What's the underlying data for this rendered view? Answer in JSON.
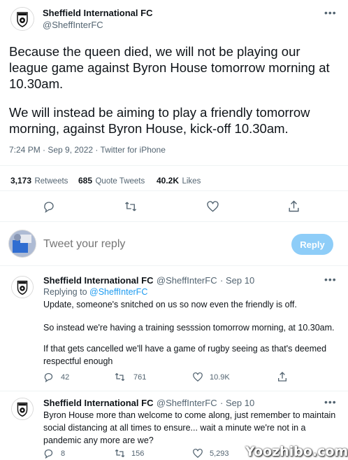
{
  "main_tweet": {
    "author_name": "Sheffield International FC",
    "author_handle": "@SheffInterFC",
    "more_icon": "more-dots-icon",
    "text_p1": "Because the queen died, we will not be playing our league game against Byron House tomorrow morning at 10.30am.",
    "text_p2": "We will instead be aiming to play a friendly tomorrow morning, against Byron House, kick-off 10.30am.",
    "timestamp": "7:24 PM · Sep 9, 2022 · Twitter for iPhone",
    "stats": {
      "retweets_count": "3,173",
      "retweets_label": "Retweets",
      "quotes_count": "685",
      "quotes_label": "Quote Tweets",
      "likes_count": "40.2K",
      "likes_label": "Likes"
    },
    "actions": [
      "reply-icon",
      "retweet-icon",
      "like-icon",
      "share-icon"
    ]
  },
  "composer": {
    "placeholder": "Tweet your reply",
    "reply_button": "Reply"
  },
  "replies": [
    {
      "author_name": "Sheffield International FC",
      "author_handle": "@SheffInterFC",
      "date": "· Sep 10",
      "replying_prefix": "Replying to ",
      "replying_to": "@SheffInterFC",
      "p1": "Update, someone's snitched on us so now even the friendly is off.",
      "p2": "So instead we're having a training sesssion tomorrow morning, at 10.30am.",
      "p3": "If that gets cancelled we'll have a game of rugby seeing as that's deemed respectful enough",
      "reply_count": "42",
      "retweet_count": "761",
      "like_count": "10.9K"
    },
    {
      "author_name": "Sheffield International FC",
      "author_handle": "@SheffInterFC",
      "date": "· Sep 10",
      "p1": "Byron House more than welcome to come along, just remember to maintain social distancing at all times to ensure... wait a minute we're not in a pandemic any more are we?",
      "reply_count": "8",
      "retweet_count": "156",
      "like_count": "5,293"
    }
  ],
  "watermark": "Yoozhibo.com"
}
